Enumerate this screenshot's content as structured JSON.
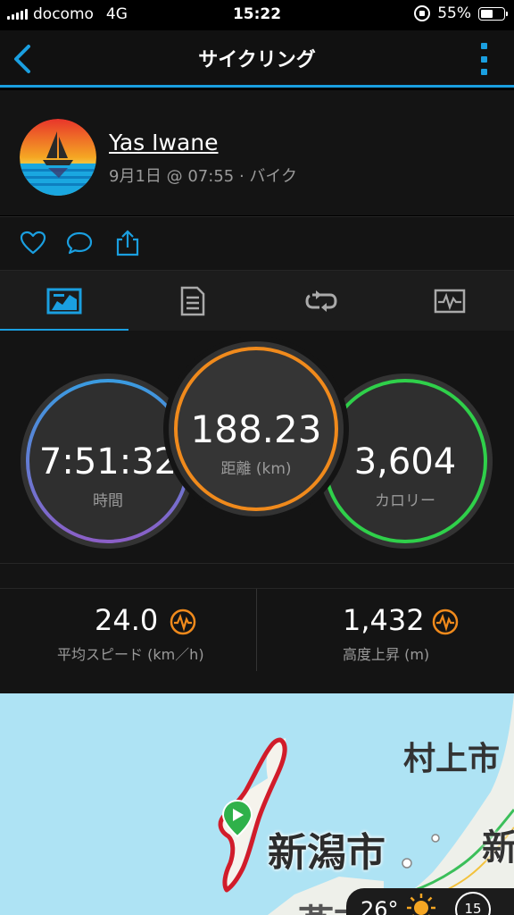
{
  "status_bar": {
    "carrier": "docomo",
    "network": "4G",
    "time": "15:22",
    "battery_percent": "55%",
    "battery_level": 0.55
  },
  "nav": {
    "title": "サイクリング",
    "back_icon": "chevron-left-icon",
    "more_icon": "vertical-dots-icon",
    "accent_color": "#1a9fe0"
  },
  "activity": {
    "user_name": "Yas Iwane",
    "meta": "9月1日 @ 07:55 · バイク"
  },
  "actions": {
    "icons": [
      "heart-icon",
      "comment-icon",
      "share-icon"
    ]
  },
  "tabs": [
    {
      "icon": "map-chart-icon",
      "active": true
    },
    {
      "icon": "details-icon",
      "active": false
    },
    {
      "icon": "laps-icon",
      "active": false
    },
    {
      "icon": "graph-icon",
      "active": false
    }
  ],
  "summary": {
    "time": {
      "value": "7:51:32",
      "label": "時間"
    },
    "distance": {
      "value": "188.23",
      "label": "距離 (km)"
    },
    "calories": {
      "value": "3,604",
      "label": "カロリー"
    },
    "ring_colors": {
      "time": [
        "#3a9be0",
        "#8b5fc7"
      ],
      "distance": "#f08a1c",
      "calories": "#2fd04a"
    }
  },
  "stats": {
    "avg_speed": {
      "value": "24.0",
      "label": "平均スピード (km／h)",
      "icon": "pulse-icon"
    },
    "elevation_gain": {
      "value": "1,432",
      "label": "高度上昇 (m)",
      "icon": "pulse-icon"
    },
    "icon_color": "#f08a1c"
  },
  "map": {
    "labels": [
      "村上市",
      "新潟市",
      "新",
      "燕市"
    ],
    "start_marker_icon": "play-icon",
    "route_color": "#d11c2a",
    "weather_temp": "26°",
    "weather_icon": "sun-icon",
    "weather_wind": "15"
  }
}
